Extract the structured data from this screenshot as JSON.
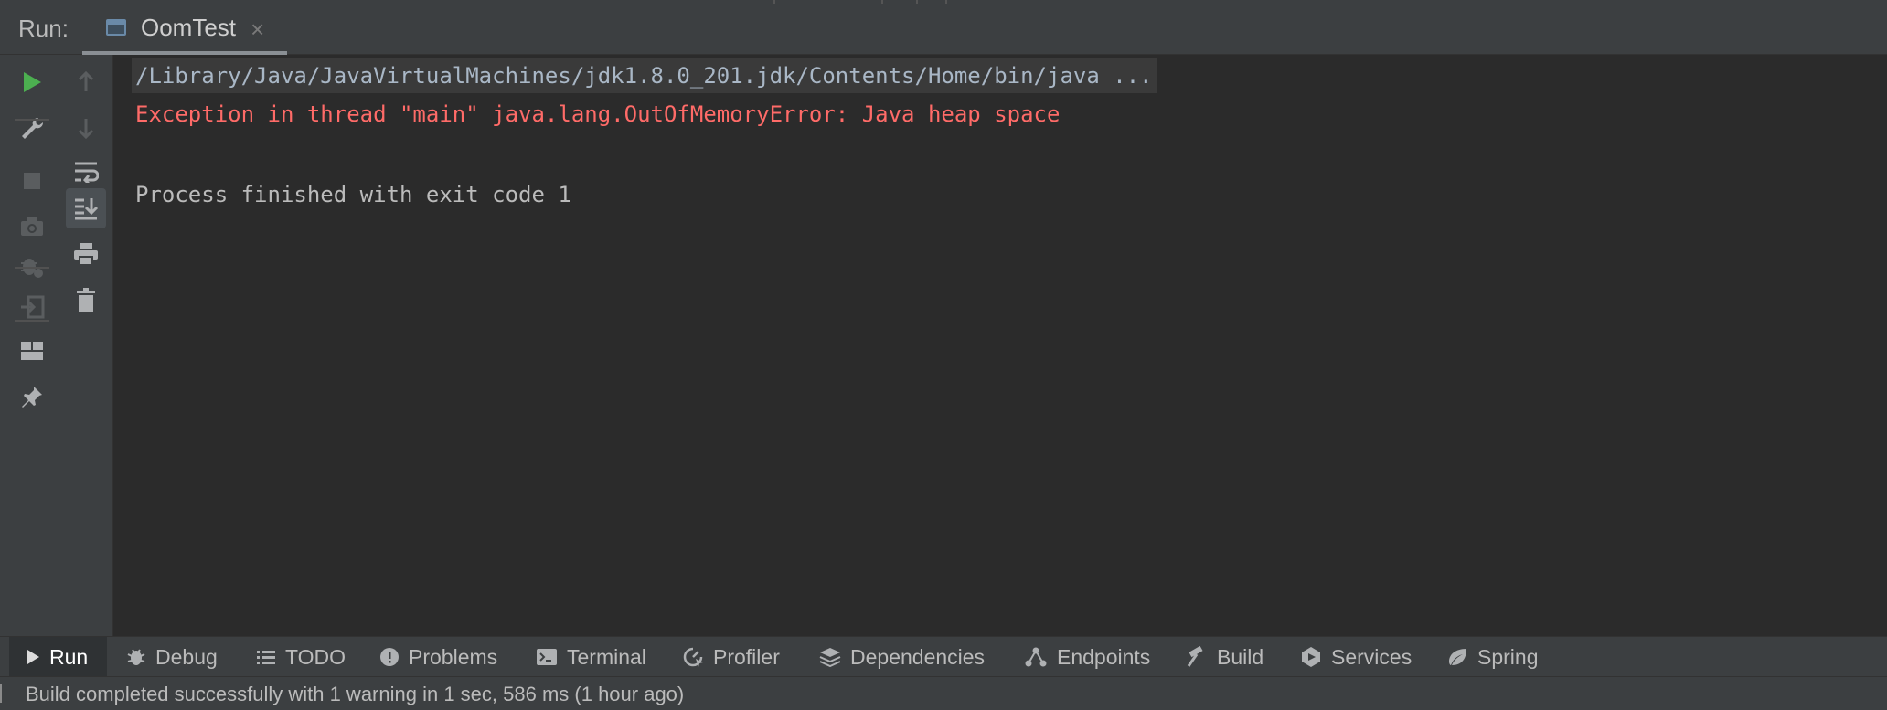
{
  "header": {
    "run_label": "Run:",
    "tab": {
      "label": "OomTest",
      "close_glyph": "×",
      "icon": "console-window-icon"
    }
  },
  "left_toolbar": [
    {
      "name": "rerun-icon"
    },
    {
      "name": "wrench-icon"
    },
    {
      "name": "stop-icon"
    },
    {
      "name": "camera-icon"
    },
    {
      "name": "debug-settings-icon"
    },
    {
      "name": "exit-icon"
    },
    {
      "name": "layout-icon"
    },
    {
      "name": "pin-icon"
    }
  ],
  "right_toolbar": [
    {
      "name": "arrow-up-icon"
    },
    {
      "name": "arrow-down-icon"
    },
    {
      "name": "soft-wrap-icon"
    },
    {
      "name": "scroll-to-end-icon"
    },
    {
      "name": "print-icon"
    },
    {
      "name": "trash-icon"
    }
  ],
  "console": {
    "command_line": "/Library/Java/JavaVirtualMachines/jdk1.8.0_201.jdk/Contents/Home/bin/java ...",
    "error_line": "Exception in thread \"main\" java.lang.OutOfMemoryError: Java heap space",
    "process_line": "Process finished with exit code 1"
  },
  "bottom_tabs": [
    {
      "label": "Run",
      "icon": "play-icon",
      "active": true
    },
    {
      "label": "Debug",
      "icon": "bug-icon"
    },
    {
      "label": "TODO",
      "icon": "list-icon"
    },
    {
      "label": "Problems",
      "icon": "warning-icon"
    },
    {
      "label": "Terminal",
      "icon": "terminal-icon"
    },
    {
      "label": "Profiler",
      "icon": "profiler-icon"
    },
    {
      "label": "Dependencies",
      "icon": "layers-icon"
    },
    {
      "label": "Endpoints",
      "icon": "endpoints-icon"
    },
    {
      "label": "Build",
      "icon": "hammer-icon"
    },
    {
      "label": "Services",
      "icon": "services-icon"
    },
    {
      "label": "Spring",
      "icon": "leaf-icon"
    }
  ],
  "status": {
    "text": "Build completed successfully with 1 warning in 1 sec, 586 ms (1 hour ago)"
  },
  "colors": {
    "background": "#2b2b2b",
    "panel": "#3c3f41",
    "error": "#ff6b68",
    "run_green": "#4caf50"
  }
}
